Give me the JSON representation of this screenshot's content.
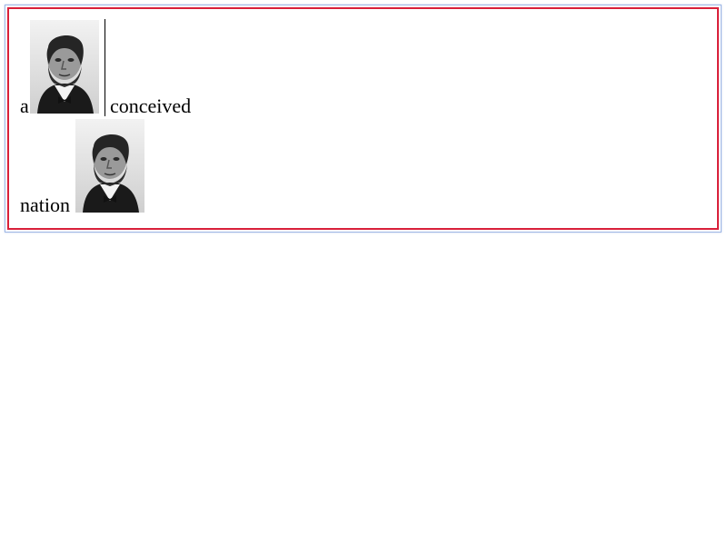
{
  "text": {
    "word_a": "a",
    "word_conceived": "conceived",
    "word_nation": "nation"
  },
  "images": [
    {
      "name": "portrait-image",
      "icon": "portrait-icon"
    },
    {
      "name": "portrait-image",
      "icon": "portrait-icon"
    }
  ],
  "colors": {
    "outer_border": "#9fb8e6",
    "inner_border": "#d9203a",
    "text": "#000000",
    "background": "#ffffff"
  }
}
